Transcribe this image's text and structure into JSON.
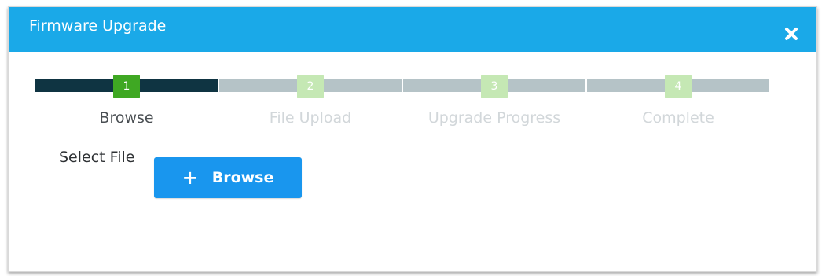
{
  "dialog": {
    "title": "Firmware Upgrade",
    "close_icon": "close-icon"
  },
  "stepper": {
    "steps": [
      {
        "number": "1",
        "label": "Browse",
        "active": true
      },
      {
        "number": "2",
        "label": "File Upload",
        "active": false
      },
      {
        "number": "3",
        "label": "Upgrade Progress",
        "active": false
      },
      {
        "number": "4",
        "label": "Complete",
        "active": false
      }
    ]
  },
  "form": {
    "select_file_label": "Select File",
    "browse_button_label": "Browse",
    "browse_icon": "plus-icon"
  },
  "colors": {
    "header": "#1aa9e8",
    "active_bar": "#0f3442",
    "inactive_bar": "#b5c3c7",
    "active_step": "#3fa823",
    "inactive_step": "#c5e8b4",
    "button": "#1996ee"
  }
}
